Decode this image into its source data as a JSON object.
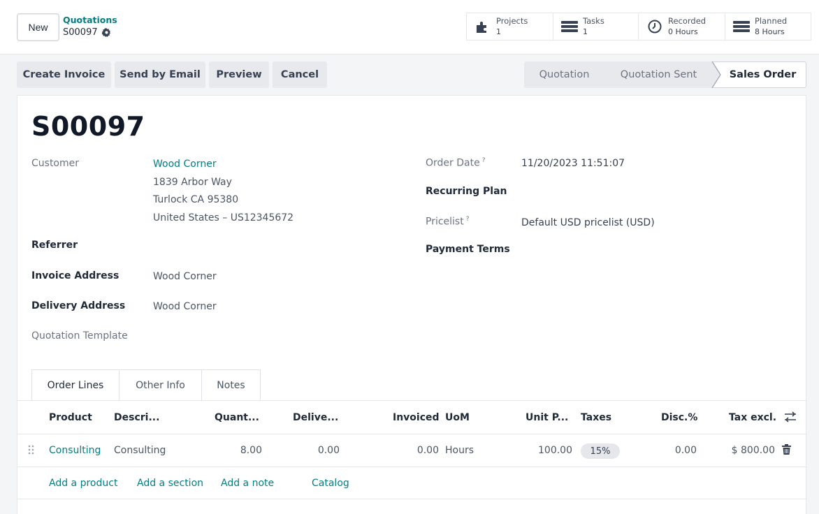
{
  "control_panel": {
    "new_label": "New",
    "breadcrumb_parent": "Quotations",
    "breadcrumb_current": "S00097"
  },
  "smart_buttons": [
    {
      "label": "Projects",
      "value": "1",
      "icon": "puzzle-icon"
    },
    {
      "label": "Tasks",
      "value": "1",
      "icon": "tasks-icon"
    },
    {
      "label": "Recorded",
      "value": "0 Hours",
      "icon": "clock-icon"
    },
    {
      "label": "Planned",
      "value": "8 Hours",
      "icon": "planning-icon"
    }
  ],
  "actions": [
    "Create Invoice",
    "Send by Email",
    "Preview",
    "Cancel"
  ],
  "status_stages": {
    "items": [
      "Quotation",
      "Quotation Sent",
      "Sales Order"
    ],
    "current": "Sales Order"
  },
  "form": {
    "title": "S00097",
    "customer_label": "Customer",
    "customer_name": "Wood Corner",
    "address_line1": "1839 Arbor Way",
    "address_line2": "Turlock CA 95380",
    "address_line3": "United States – US12345672",
    "referrer_label": "Referrer",
    "invoice_address_label": "Invoice Address",
    "invoice_address_value": "Wood Corner",
    "delivery_address_label": "Delivery Address",
    "delivery_address_value": "Wood Corner",
    "quotation_template_label": "Quotation Template",
    "order_date_label": "Order Date",
    "order_date_value": "11/20/2023 11:51:07",
    "recurring_plan_label": "Recurring Plan",
    "pricelist_label": "Pricelist",
    "pricelist_value": "Default USD pricelist (USD)",
    "payment_terms_label": "Payment Terms",
    "help_mark": "?"
  },
  "tabs": [
    "Order Lines",
    "Other Info",
    "Notes"
  ],
  "order_lines": {
    "headers": {
      "product": "Product",
      "description": "Descri...",
      "quantity": "Quant...",
      "delivered": "Delive...",
      "invoiced": "Invoiced",
      "uom": "UoM",
      "unit_price": "Unit P...",
      "taxes": "Taxes",
      "discount": "Disc.%",
      "subtotal": "Tax excl."
    },
    "rows": [
      {
        "product": "Consulting",
        "description": "Consulting",
        "quantity": "8.00",
        "delivered": "0.00",
        "invoiced": "0.00",
        "uom": "Hours",
        "unit_price": "100.00",
        "taxes": "15%",
        "discount": "0.00",
        "subtotal": "$ 800.00"
      }
    ],
    "add_links": [
      "Add a product",
      "Add a section",
      "Add a note",
      "Catalog"
    ]
  },
  "colors": {
    "link": "#017e84",
    "button_bg": "#e7e9ed"
  }
}
